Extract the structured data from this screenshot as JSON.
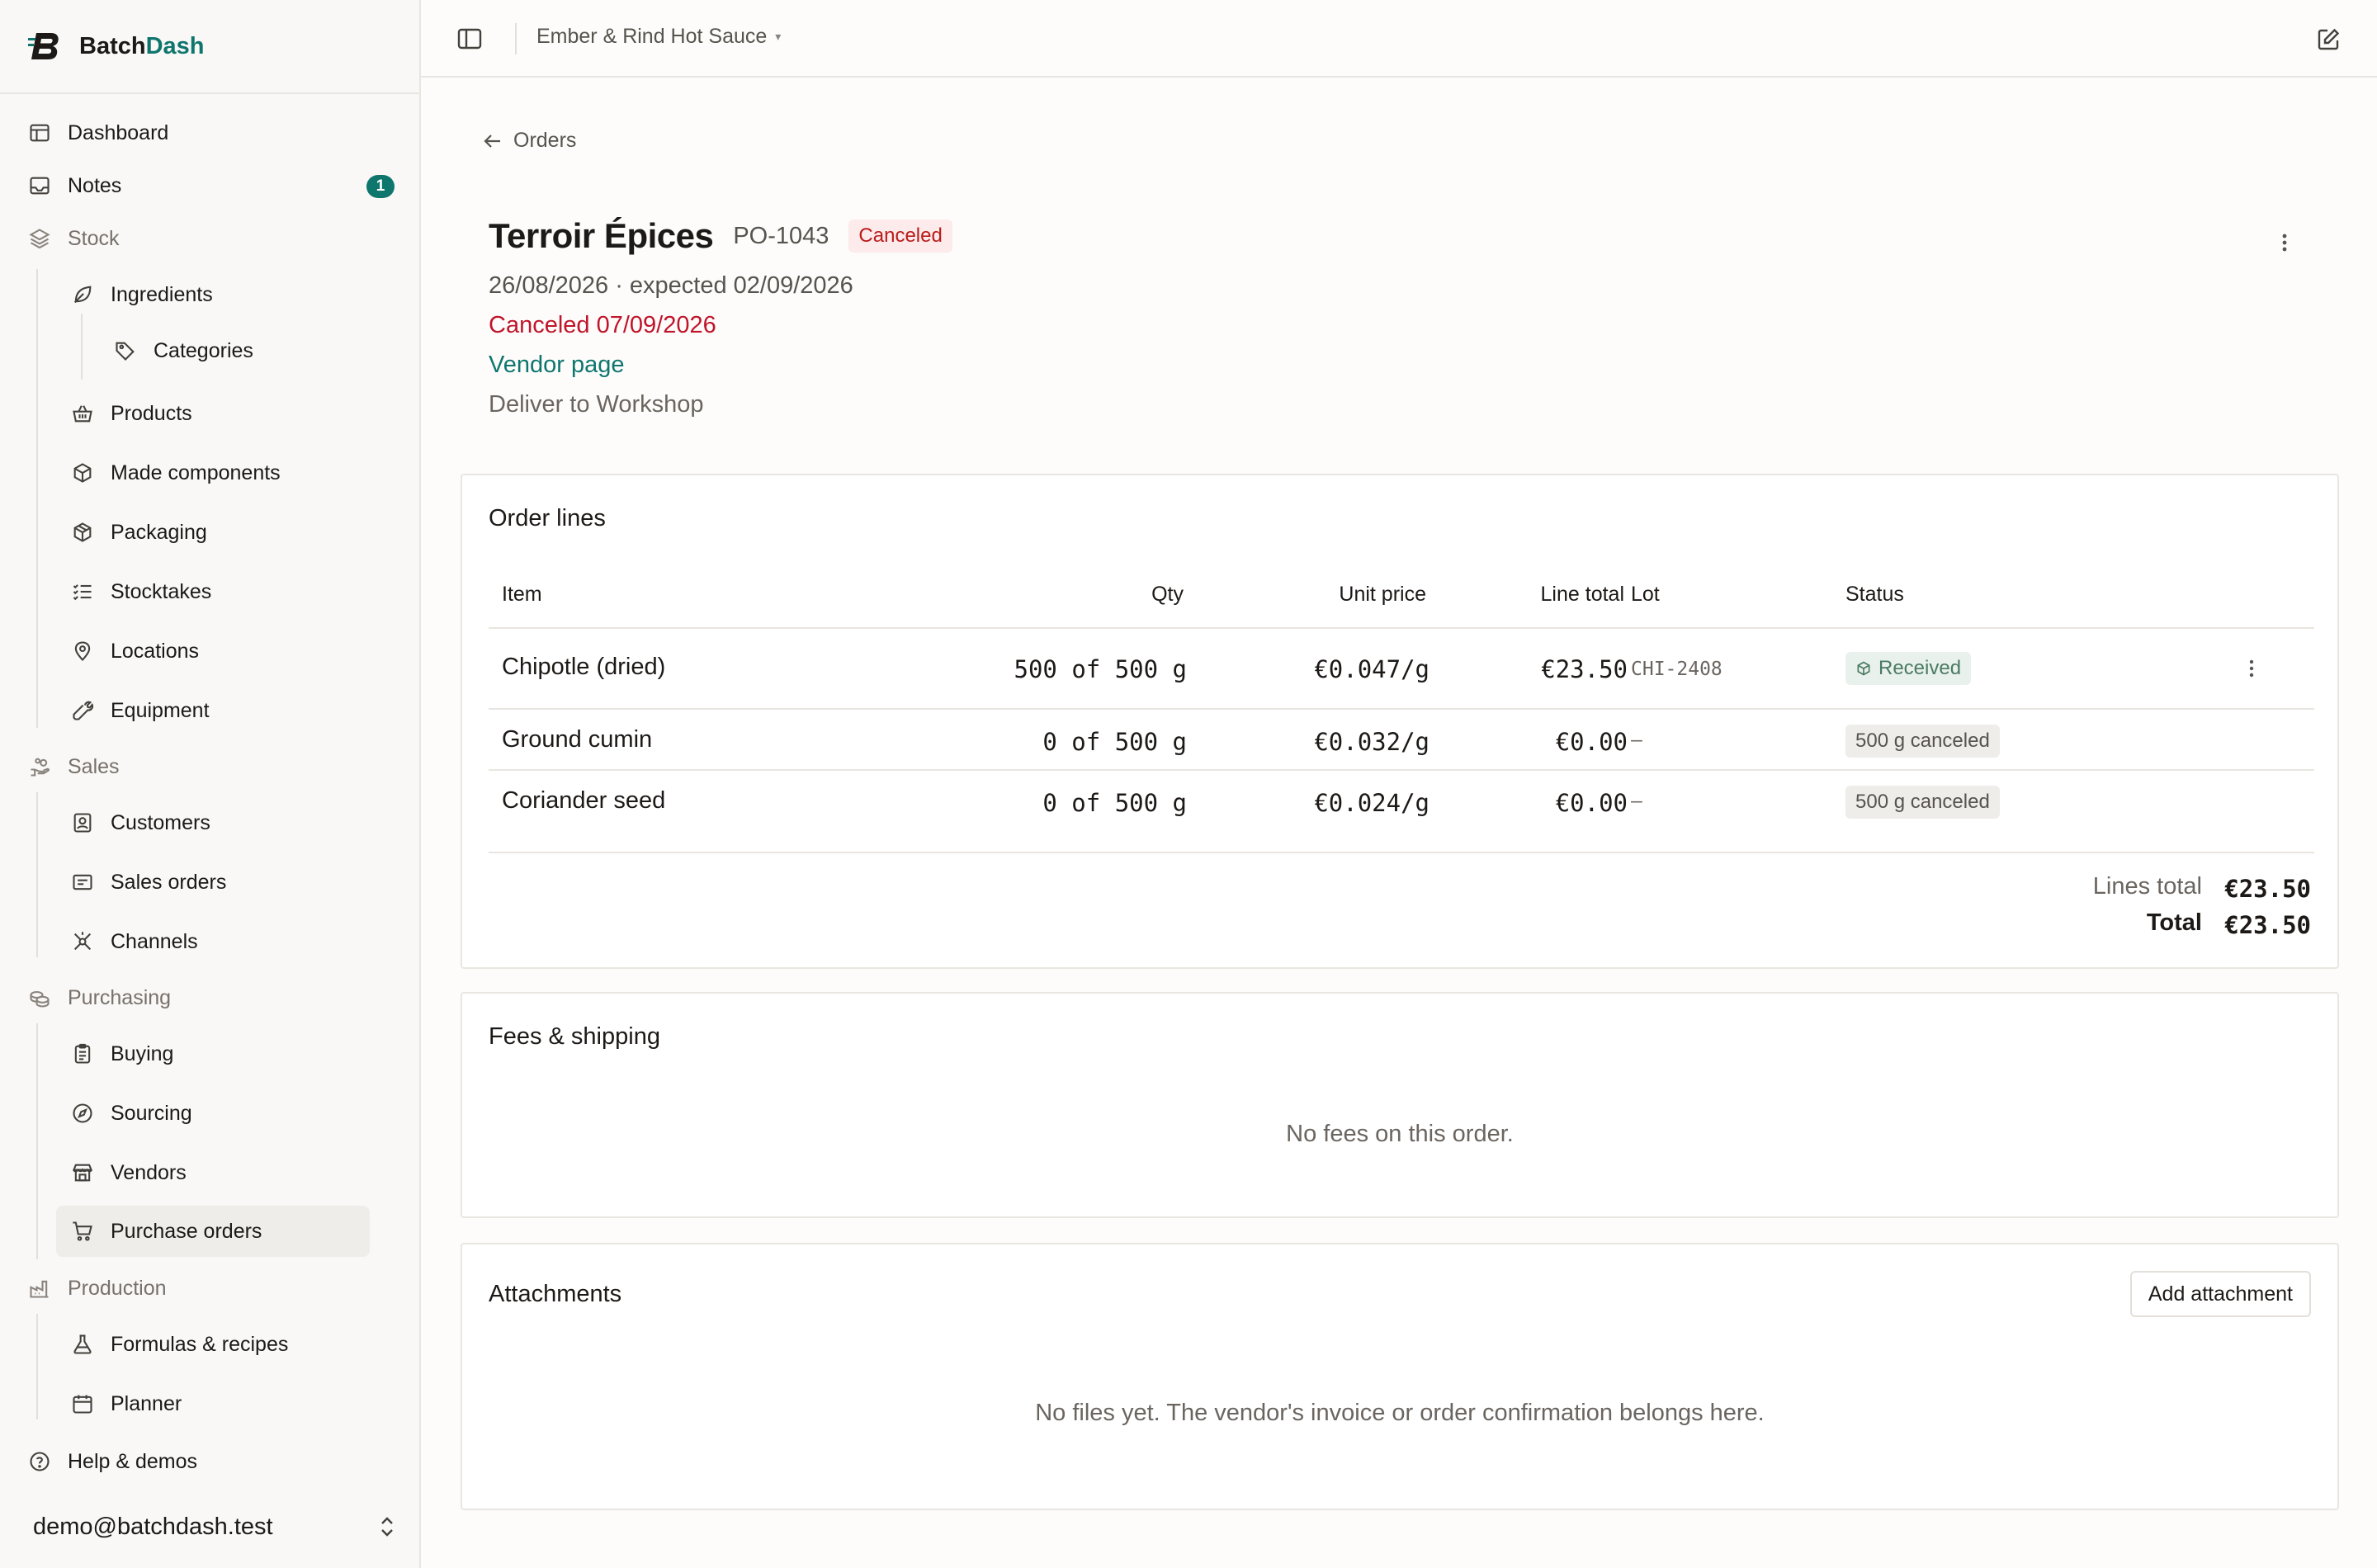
{
  "brand": {
    "logo": "B",
    "name_part1": "Batch",
    "name_part2": "Dash"
  },
  "sidebar": {
    "items": [
      {
        "label": "Dashboard",
        "icon": "layout-icon"
      },
      {
        "label": "Notes",
        "icon": "inbox-icon",
        "badge": "1"
      },
      {
        "label": "Stock",
        "icon": "layers-icon",
        "section": true
      },
      {
        "label": "Ingredients",
        "icon": "leaf-icon"
      },
      {
        "label": "Categories",
        "icon": "tag-icon"
      },
      {
        "label": "Products",
        "icon": "basket-icon"
      },
      {
        "label": "Made components",
        "icon": "box-icon"
      },
      {
        "label": "Packaging",
        "icon": "package-icon"
      },
      {
        "label": "Stocktakes",
        "icon": "checklist-icon"
      },
      {
        "label": "Locations",
        "icon": "map-pin-icon"
      },
      {
        "label": "Equipment",
        "icon": "wrench-icon"
      },
      {
        "label": "Sales",
        "icon": "hand-coins-icon",
        "section": true
      },
      {
        "label": "Customers",
        "icon": "contact-icon"
      },
      {
        "label": "Sales orders",
        "icon": "receipt-icon"
      },
      {
        "label": "Channels",
        "icon": "network-icon"
      },
      {
        "label": "Purchasing",
        "icon": "coins-icon",
        "section": true
      },
      {
        "label": "Buying",
        "icon": "clipboard-icon"
      },
      {
        "label": "Sourcing",
        "icon": "compass-icon"
      },
      {
        "label": "Vendors",
        "icon": "store-icon"
      },
      {
        "label": "Purchase orders",
        "icon": "cart-icon",
        "active": true
      },
      {
        "label": "Production",
        "icon": "factory-icon",
        "section": true
      },
      {
        "label": "Formulas & recipes",
        "icon": "flask-icon"
      },
      {
        "label": "Planner",
        "icon": "calendar-icon"
      },
      {
        "label": "Help & demos",
        "icon": "help-icon"
      }
    ],
    "user_email": "demo@batchdash.test"
  },
  "topbar": {
    "company": "Ember & Rind Hot Sauce"
  },
  "order": {
    "back_label": "Orders",
    "vendor": "Terroir Épices",
    "number": "PO-1043",
    "status": "Canceled",
    "dates": "26/08/2026 · expected 02/09/2026",
    "canceled": "Canceled 07/09/2026",
    "vendor_link": "Vendor page",
    "deliver_to": "Deliver to Workshop"
  },
  "order_lines": {
    "title": "Order lines",
    "headers": {
      "item": "Item",
      "qty": "Qty",
      "unit_price": "Unit price",
      "line_total": "Line total",
      "lot": "Lot",
      "status": "Status"
    },
    "rows": [
      {
        "item": "Chipotle (dried)",
        "qty": "500 of 500 g",
        "unit_price": "€0.047/g",
        "line_total": "€23.50",
        "lot": "CHI-2408",
        "status": "Received"
      },
      {
        "item": "Ground cumin",
        "qty": "0 of 500 g",
        "unit_price": "€0.032/g",
        "line_total": "€0.00",
        "lot": "–",
        "status": "500 g canceled"
      },
      {
        "item": "Coriander seed",
        "qty": "0 of 500 g",
        "unit_price": "€0.024/g",
        "line_total": "€0.00",
        "lot": "–",
        "status": "500 g canceled"
      }
    ],
    "lines_total_label": "Lines total",
    "lines_total": "€23.50",
    "total_label": "Total",
    "total": "€23.50"
  },
  "fees": {
    "title": "Fees & shipping",
    "empty": "No fees on this order."
  },
  "attachments": {
    "title": "Attachments",
    "add_label": "Add attachment",
    "empty": "No files yet. The vendor's invoice or order confirmation belongs here."
  }
}
